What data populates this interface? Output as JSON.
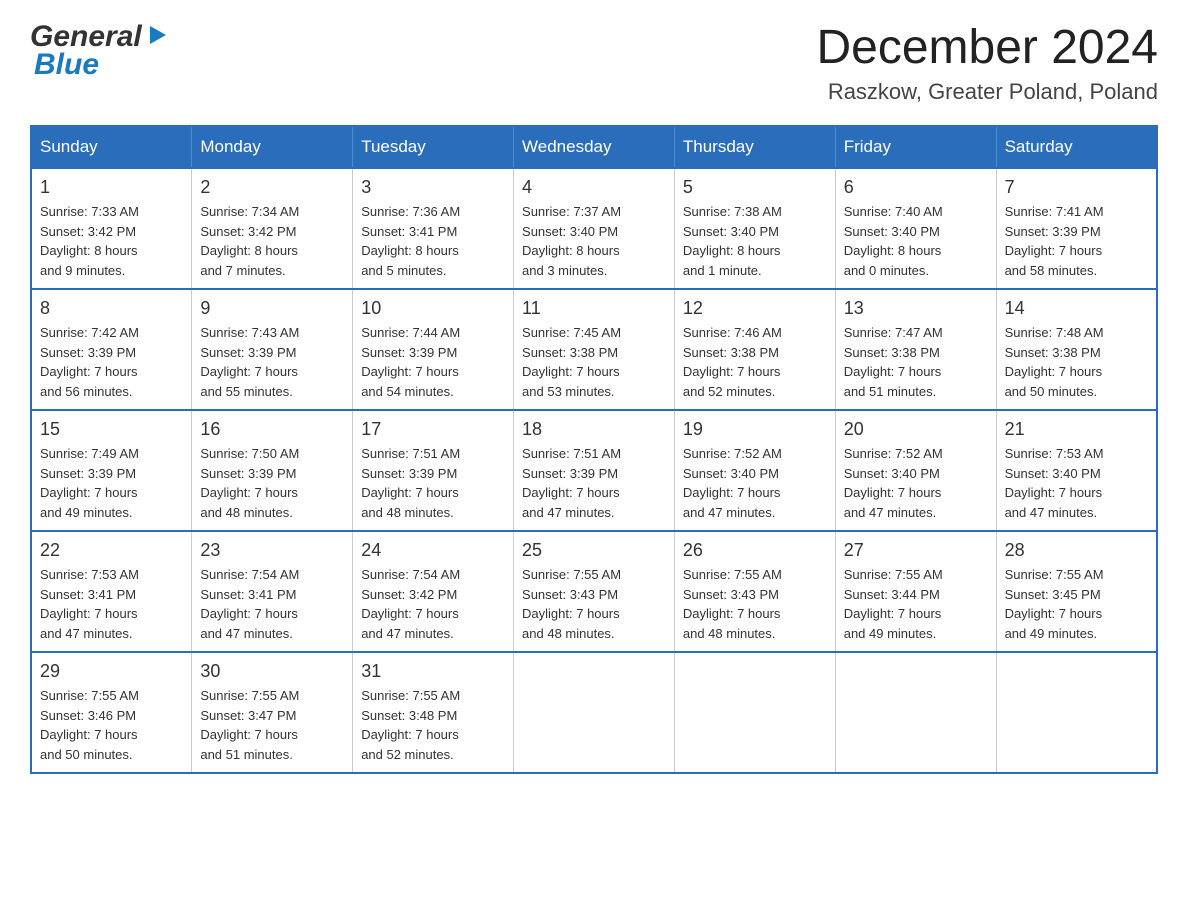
{
  "header": {
    "logo_general": "General",
    "logo_blue": "Blue",
    "month_title": "December 2024",
    "location": "Raszkow, Greater Poland, Poland"
  },
  "calendar": {
    "days_of_week": [
      "Sunday",
      "Monday",
      "Tuesday",
      "Wednesday",
      "Thursday",
      "Friday",
      "Saturday"
    ],
    "weeks": [
      [
        {
          "day": "1",
          "sunrise": "Sunrise: 7:33 AM",
          "sunset": "Sunset: 3:42 PM",
          "daylight": "Daylight: 8 hours and 9 minutes."
        },
        {
          "day": "2",
          "sunrise": "Sunrise: 7:34 AM",
          "sunset": "Sunset: 3:42 PM",
          "daylight": "Daylight: 8 hours and 7 minutes."
        },
        {
          "day": "3",
          "sunrise": "Sunrise: 7:36 AM",
          "sunset": "Sunset: 3:41 PM",
          "daylight": "Daylight: 8 hours and 5 minutes."
        },
        {
          "day": "4",
          "sunrise": "Sunrise: 7:37 AM",
          "sunset": "Sunset: 3:40 PM",
          "daylight": "Daylight: 8 hours and 3 minutes."
        },
        {
          "day": "5",
          "sunrise": "Sunrise: 7:38 AM",
          "sunset": "Sunset: 3:40 PM",
          "daylight": "Daylight: 8 hours and 1 minute."
        },
        {
          "day": "6",
          "sunrise": "Sunrise: 7:40 AM",
          "sunset": "Sunset: 3:40 PM",
          "daylight": "Daylight: 8 hours and 0 minutes."
        },
        {
          "day": "7",
          "sunrise": "Sunrise: 7:41 AM",
          "sunset": "Sunset: 3:39 PM",
          "daylight": "Daylight: 7 hours and 58 minutes."
        }
      ],
      [
        {
          "day": "8",
          "sunrise": "Sunrise: 7:42 AM",
          "sunset": "Sunset: 3:39 PM",
          "daylight": "Daylight: 7 hours and 56 minutes."
        },
        {
          "day": "9",
          "sunrise": "Sunrise: 7:43 AM",
          "sunset": "Sunset: 3:39 PM",
          "daylight": "Daylight: 7 hours and 55 minutes."
        },
        {
          "day": "10",
          "sunrise": "Sunrise: 7:44 AM",
          "sunset": "Sunset: 3:39 PM",
          "daylight": "Daylight: 7 hours and 54 minutes."
        },
        {
          "day": "11",
          "sunrise": "Sunrise: 7:45 AM",
          "sunset": "Sunset: 3:38 PM",
          "daylight": "Daylight: 7 hours and 53 minutes."
        },
        {
          "day": "12",
          "sunrise": "Sunrise: 7:46 AM",
          "sunset": "Sunset: 3:38 PM",
          "daylight": "Daylight: 7 hours and 52 minutes."
        },
        {
          "day": "13",
          "sunrise": "Sunrise: 7:47 AM",
          "sunset": "Sunset: 3:38 PM",
          "daylight": "Daylight: 7 hours and 51 minutes."
        },
        {
          "day": "14",
          "sunrise": "Sunrise: 7:48 AM",
          "sunset": "Sunset: 3:38 PM",
          "daylight": "Daylight: 7 hours and 50 minutes."
        }
      ],
      [
        {
          "day": "15",
          "sunrise": "Sunrise: 7:49 AM",
          "sunset": "Sunset: 3:39 PM",
          "daylight": "Daylight: 7 hours and 49 minutes."
        },
        {
          "day": "16",
          "sunrise": "Sunrise: 7:50 AM",
          "sunset": "Sunset: 3:39 PM",
          "daylight": "Daylight: 7 hours and 48 minutes."
        },
        {
          "day": "17",
          "sunrise": "Sunrise: 7:51 AM",
          "sunset": "Sunset: 3:39 PM",
          "daylight": "Daylight: 7 hours and 48 minutes."
        },
        {
          "day": "18",
          "sunrise": "Sunrise: 7:51 AM",
          "sunset": "Sunset: 3:39 PM",
          "daylight": "Daylight: 7 hours and 47 minutes."
        },
        {
          "day": "19",
          "sunrise": "Sunrise: 7:52 AM",
          "sunset": "Sunset: 3:40 PM",
          "daylight": "Daylight: 7 hours and 47 minutes."
        },
        {
          "day": "20",
          "sunrise": "Sunrise: 7:52 AM",
          "sunset": "Sunset: 3:40 PM",
          "daylight": "Daylight: 7 hours and 47 minutes."
        },
        {
          "day": "21",
          "sunrise": "Sunrise: 7:53 AM",
          "sunset": "Sunset: 3:40 PM",
          "daylight": "Daylight: 7 hours and 47 minutes."
        }
      ],
      [
        {
          "day": "22",
          "sunrise": "Sunrise: 7:53 AM",
          "sunset": "Sunset: 3:41 PM",
          "daylight": "Daylight: 7 hours and 47 minutes."
        },
        {
          "day": "23",
          "sunrise": "Sunrise: 7:54 AM",
          "sunset": "Sunset: 3:41 PM",
          "daylight": "Daylight: 7 hours and 47 minutes."
        },
        {
          "day": "24",
          "sunrise": "Sunrise: 7:54 AM",
          "sunset": "Sunset: 3:42 PM",
          "daylight": "Daylight: 7 hours and 47 minutes."
        },
        {
          "day": "25",
          "sunrise": "Sunrise: 7:55 AM",
          "sunset": "Sunset: 3:43 PM",
          "daylight": "Daylight: 7 hours and 48 minutes."
        },
        {
          "day": "26",
          "sunrise": "Sunrise: 7:55 AM",
          "sunset": "Sunset: 3:43 PM",
          "daylight": "Daylight: 7 hours and 48 minutes."
        },
        {
          "day": "27",
          "sunrise": "Sunrise: 7:55 AM",
          "sunset": "Sunset: 3:44 PM",
          "daylight": "Daylight: 7 hours and 49 minutes."
        },
        {
          "day": "28",
          "sunrise": "Sunrise: 7:55 AM",
          "sunset": "Sunset: 3:45 PM",
          "daylight": "Daylight: 7 hours and 49 minutes."
        }
      ],
      [
        {
          "day": "29",
          "sunrise": "Sunrise: 7:55 AM",
          "sunset": "Sunset: 3:46 PM",
          "daylight": "Daylight: 7 hours and 50 minutes."
        },
        {
          "day": "30",
          "sunrise": "Sunrise: 7:55 AM",
          "sunset": "Sunset: 3:47 PM",
          "daylight": "Daylight: 7 hours and 51 minutes."
        },
        {
          "day": "31",
          "sunrise": "Sunrise: 7:55 AM",
          "sunset": "Sunset: 3:48 PM",
          "daylight": "Daylight: 7 hours and 52 minutes."
        },
        null,
        null,
        null,
        null
      ]
    ]
  }
}
